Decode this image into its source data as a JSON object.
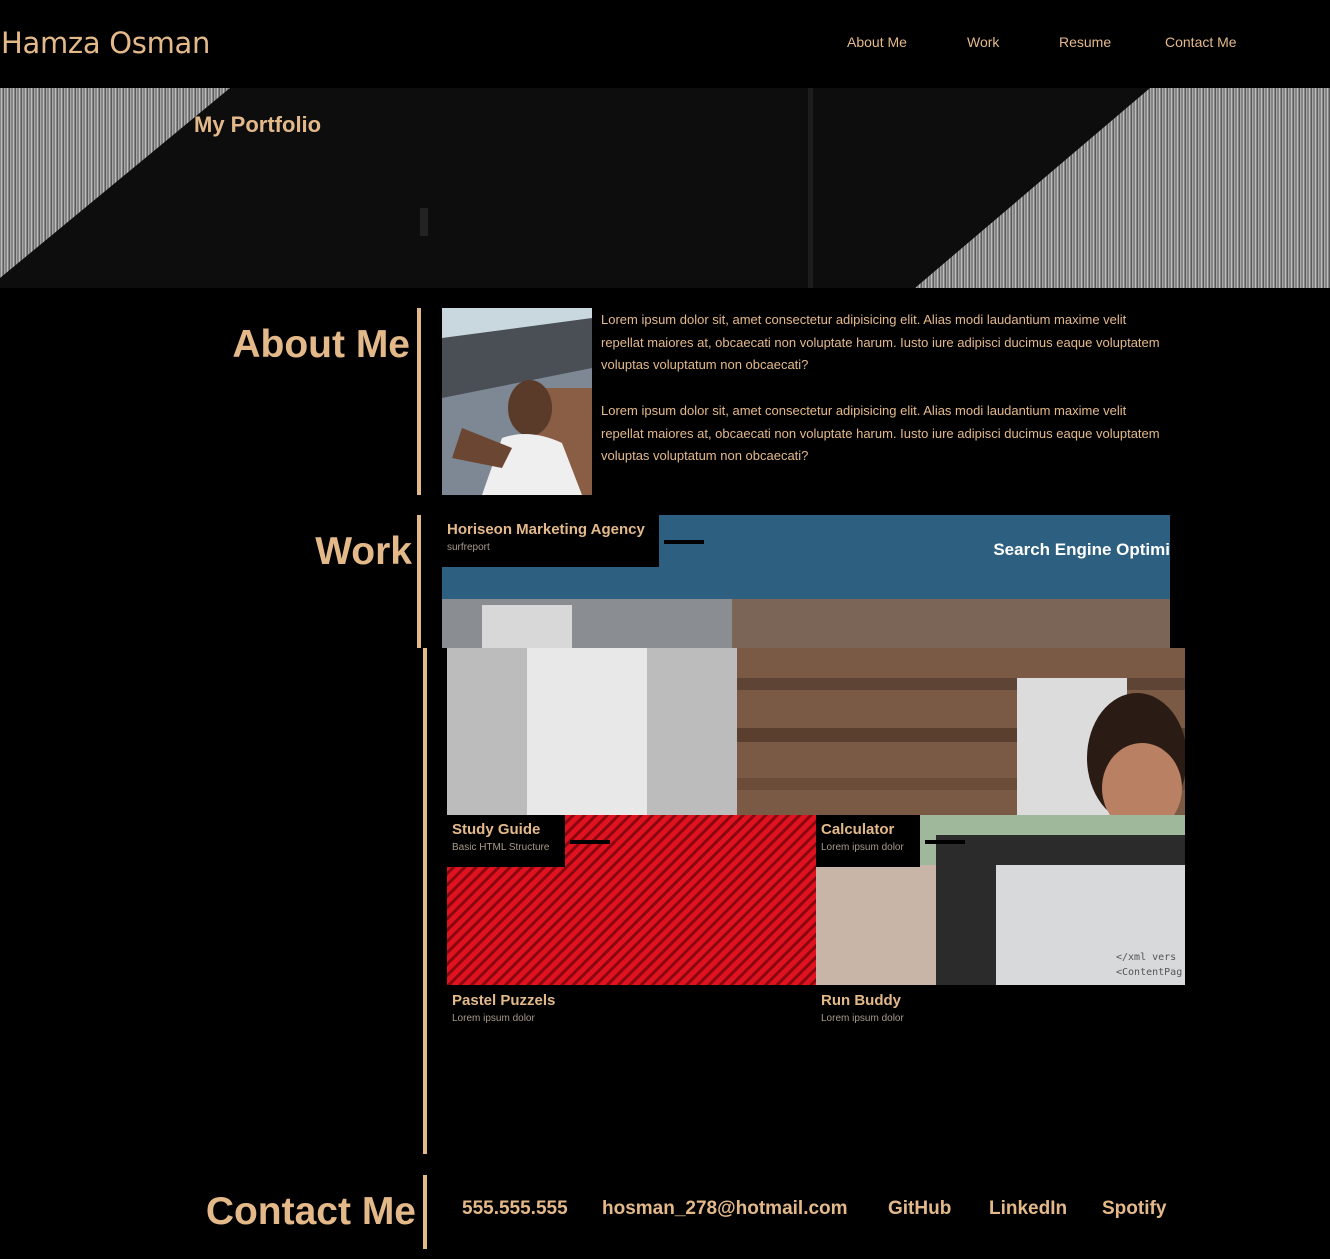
{
  "header": {
    "brand": "Hamza Osman",
    "nav": [
      "About Me",
      "Work",
      "Resume",
      "Contact Me"
    ]
  },
  "hero": {
    "title": "My Portfolio"
  },
  "about": {
    "heading": "About Me",
    "paragraphs": [
      "Lorem ipsum dolor sit, amet consectetur adipisicing elit. Alias modi laudantium maxime velit repellat maiores at, obcaecati non voluptate harum. Iusto iure adipisci ducimus eaque voluptatem voluptas voluptatum non obcaecati?",
      "Lorem ipsum dolor sit, amet consectetur adipisicing elit. Alias modi laudantium maxime velit repellat maiores at, obcaecati non voluptate harum. Iusto iure adipisci ducimus eaque voluptatem voluptas voluptatum non obcaecati?"
    ]
  },
  "work": {
    "heading": "Work",
    "featured": {
      "title": "Horiseon Marketing Agency",
      "subtitle": "surfreport",
      "banner_text": "Search Engine Optimi"
    },
    "projects": [
      {
        "title": "Study Guide",
        "subtitle": "Basic HTML Structure"
      },
      {
        "title": "Calculator",
        "subtitle": "Lorem ipsum dolor"
      },
      {
        "title": "Pastel Puzzels",
        "subtitle": "Lorem ipsum dolor"
      },
      {
        "title": "Run Buddy",
        "subtitle": "Lorem ipsum dolor"
      }
    ]
  },
  "contact": {
    "heading": "Contact Me",
    "links": [
      "555.555.555",
      "hosman_278@hotmail.com",
      "GitHub",
      "LinkedIn",
      "Spotify"
    ]
  },
  "colors": {
    "accent": "#e4b98a",
    "background": "#000000",
    "banner": "#2d5f80"
  }
}
